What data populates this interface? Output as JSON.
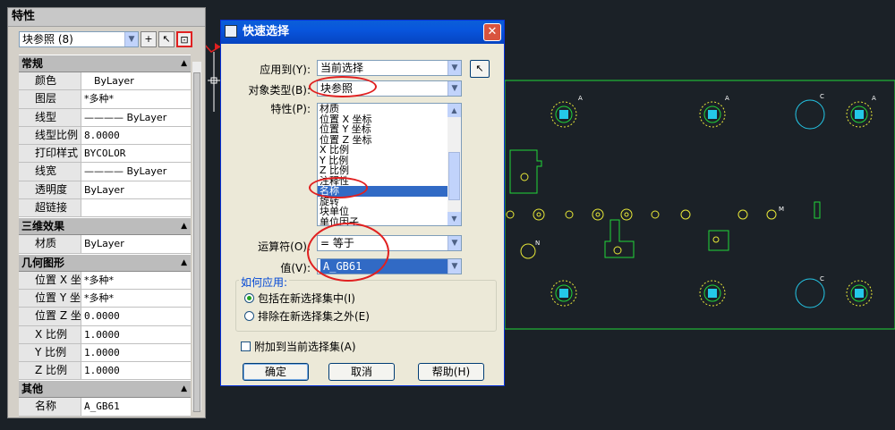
{
  "properties_panel": {
    "title": "特性",
    "selection_combo": "块参照  (8)",
    "sections": [
      {
        "title": "常规",
        "rows": [
          {
            "key": "颜色",
            "value": "ByLayer"
          },
          {
            "key": "图层",
            "value": "*多种*"
          },
          {
            "key": "线型",
            "value": "———— ByLayer"
          },
          {
            "key": "线型比例",
            "value": "8.0000"
          },
          {
            "key": "打印样式",
            "value": "BYCOLOR"
          },
          {
            "key": "线宽",
            "value": "———— ByLayer"
          },
          {
            "key": "透明度",
            "value": "ByLayer"
          },
          {
            "key": "超链接",
            "value": ""
          }
        ]
      },
      {
        "title": "三维效果",
        "rows": [
          {
            "key": "材质",
            "value": "ByLayer"
          }
        ]
      },
      {
        "title": "几何图形",
        "rows": [
          {
            "key": "位置 X 坐标",
            "value": "*多种*"
          },
          {
            "key": "位置 Y 坐标",
            "value": "*多种*"
          },
          {
            "key": "位置 Z 坐标",
            "value": "0.0000"
          },
          {
            "key": "X 比例",
            "value": "1.0000"
          },
          {
            "key": "Y 比例",
            "value": "1.0000"
          },
          {
            "key": "Z 比例",
            "value": "1.0000"
          }
        ]
      },
      {
        "title": "其他",
        "rows": [
          {
            "key": "名称",
            "value": "A_GB61"
          }
        ]
      }
    ]
  },
  "dialog": {
    "title": "快速选择",
    "close_glyph": "✕",
    "apply_to_label": "应用到(Y):",
    "apply_to_value": "当前选择",
    "object_type_label": "对象类型(B):",
    "object_type_value": "块参照",
    "properties_label": "特性(P):",
    "properties_list": [
      "材质",
      "位置 X 坐标",
      "位置 Y 坐标",
      "位置 Z 坐标",
      "X 比例",
      "Y 比例",
      "Z 比例",
      "注释性",
      "名称",
      "旋转",
      "块单位",
      "单位因子"
    ],
    "selected_property": "名称",
    "operator_label": "运算符(O):",
    "operator_value": "= 等于",
    "value_label": "值(V):",
    "value_value": "A_GB61",
    "how_to_apply_label": "如何应用:",
    "radio_include": "包括在新选择集中(I)",
    "radio_exclude": "排除在新选择集之外(E)",
    "append_checkbox": "附加到当前选择集(A)",
    "ok_button": "确定",
    "cancel_button": "取消",
    "help_button": "帮助(H)"
  },
  "drawing_labels": {
    "a": "A",
    "c": "C",
    "j": "J",
    "n": "N",
    "m": "M"
  },
  "colors": {
    "cad_background": "#1b2127",
    "cad_line": "#22d63a",
    "cad_cyan": "#24c8e8",
    "annotation_red": "#e02020",
    "dialog_title": "#0855dd",
    "selection": "#316ac5"
  }
}
